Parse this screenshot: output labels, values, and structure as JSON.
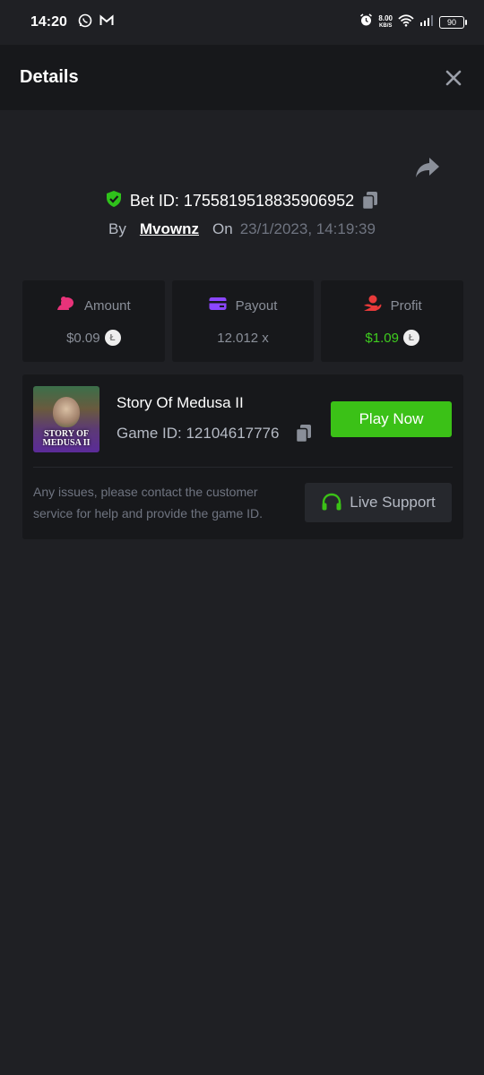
{
  "status_bar": {
    "time": "14:20",
    "network_speed": "8.00",
    "network_unit": "KB/S",
    "battery": "90",
    "icons": [
      "whatsapp-icon",
      "gmail-icon",
      "alarm-icon",
      "wifi-icon",
      "signal-icon",
      "battery-icon"
    ]
  },
  "header": {
    "title": "Details",
    "close_icon": "close-icon"
  },
  "bet": {
    "id_label": "Bet ID: 1755819518835906952",
    "by_label": "By",
    "user": "Mvownz",
    "on_label": "On",
    "date": "23/1/2023, 14:19:39"
  },
  "stats": [
    {
      "label": "Amount",
      "value": "$0.09",
      "icon": "coins-icon",
      "color": "#e8337a"
    },
    {
      "label": "Payout",
      "value": "12.012 x",
      "icon": "card-icon",
      "color": "#8b46ff"
    },
    {
      "label": "Profit",
      "value": "$1.09",
      "icon": "hand-coin-icon",
      "color": "#e83a3a"
    }
  ],
  "game": {
    "name": "Story Of Medusa II",
    "id_label": "Game ID: 12104617776",
    "thumb_text_line1": "STORY OF",
    "thumb_text_line2": "MEDUSA II",
    "play_label": "Play Now",
    "notice": "Any issues, please contact the customer service for help and provide the game ID.",
    "support_label": "Live Support"
  },
  "colors": {
    "background": "#1f2024",
    "card": "#17181b",
    "accent_green": "#3bc117",
    "profit_green": "#3fcd1f",
    "shield_green": "#2fc21b"
  }
}
